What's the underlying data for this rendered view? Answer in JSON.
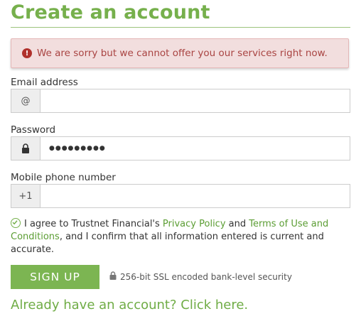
{
  "title": "Create an account",
  "alert": {
    "icon": "exclamation-circle-icon",
    "message": "We are sorry but we cannot offer you our services right now."
  },
  "email": {
    "label": "Email address",
    "addon": "@",
    "value": ""
  },
  "password": {
    "label": "Password",
    "addon_icon": "lock-icon",
    "value": "●●●●●●●●●"
  },
  "phone": {
    "label": "Mobile phone number",
    "addon": "+1",
    "value": ""
  },
  "agreement": {
    "icon": "check-circle-icon",
    "prefix": "I agree to Trustnet Financial's ",
    "privacy_link": "Privacy Policy",
    "and": " and ",
    "terms_link": "Terms of Use and Conditions",
    "suffix": ", and I confirm that all information entered is current and accurate."
  },
  "signup_button": "SIGN UP",
  "security_note": "256-bit SSL encoded bank-level security",
  "login_link": "Already have an account? Click here.",
  "colors": {
    "brand_green": "#76b04c",
    "alert_bg": "#f2dede",
    "alert_text": "#a94442"
  }
}
